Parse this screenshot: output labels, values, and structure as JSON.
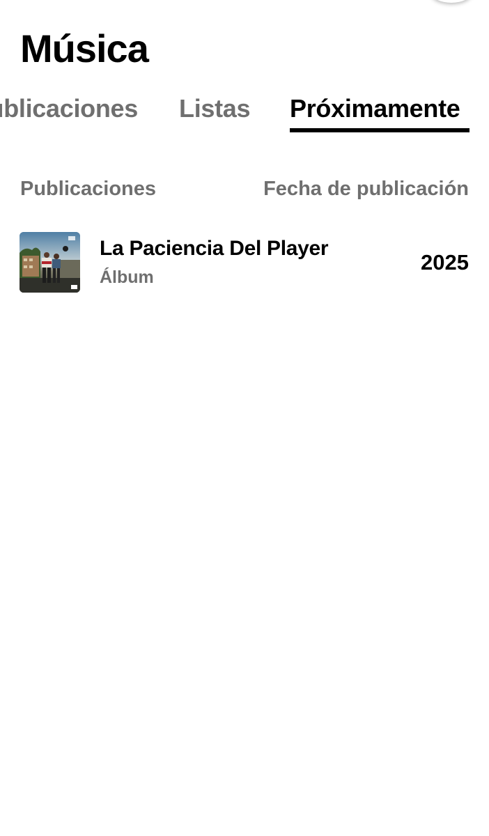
{
  "header": {
    "title": "Música"
  },
  "tabs": [
    {
      "label": "Publicaciones",
      "active": false
    },
    {
      "label": "Listas",
      "active": false
    },
    {
      "label": "Próximamente",
      "active": true
    }
  ],
  "columns": {
    "left": "Publicaciones",
    "right": "Fecha de publicación"
  },
  "releases": [
    {
      "title": "La Paciencia Del Player",
      "type": "Álbum",
      "year": "2025",
      "cover_icon": "album-cover-image"
    }
  ],
  "colors": {
    "text_primary": "#000000",
    "text_secondary": "#6f6f6f",
    "background": "#ffffff",
    "active_underline": "#000000"
  }
}
